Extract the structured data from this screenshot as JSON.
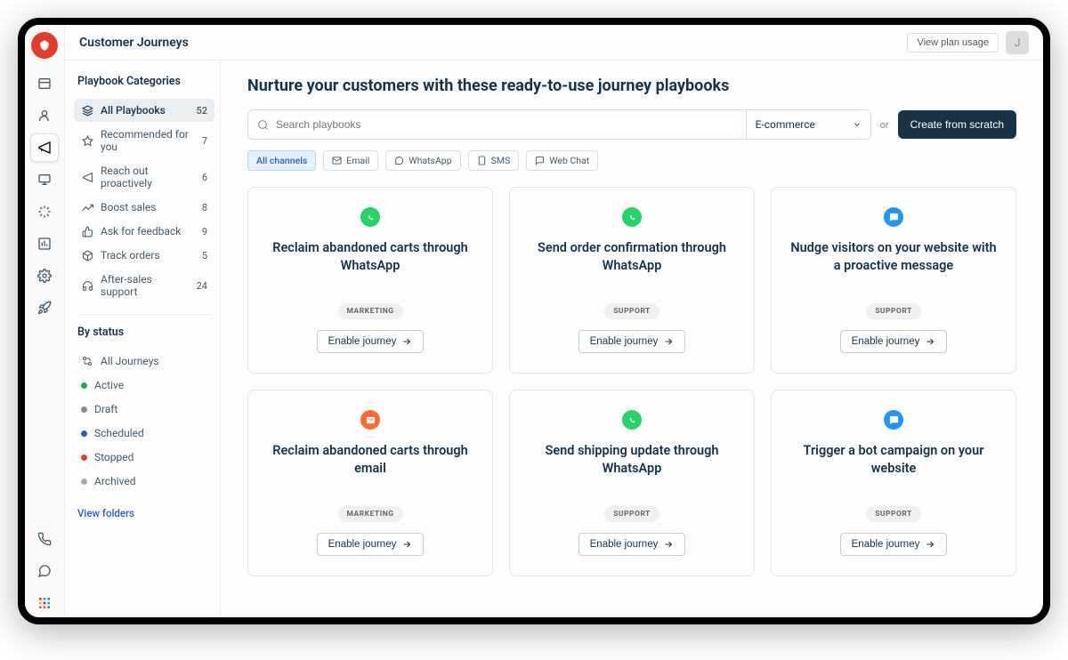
{
  "header": {
    "title": "Customer Journeys",
    "plan_button": "View plan usage",
    "avatar_initial": "J"
  },
  "sidebar": {
    "categories_heading": "Playbook Categories",
    "items": [
      {
        "label": "All Playbooks",
        "count": "52",
        "icon": "stack"
      },
      {
        "label": "Recommended for you",
        "count": "7",
        "icon": "star"
      },
      {
        "label": "Reach out proactively",
        "count": "6",
        "icon": "megaphone"
      },
      {
        "label": "Boost sales",
        "count": "8",
        "icon": "trend"
      },
      {
        "label": "Ask for feedback",
        "count": "9",
        "icon": "thumbs"
      },
      {
        "label": "Track orders",
        "count": "5",
        "icon": "package"
      },
      {
        "label": "After-sales support",
        "count": "24",
        "icon": "headset"
      }
    ],
    "status_heading": "By status",
    "status_items": [
      {
        "label": "All Journeys",
        "color": ""
      },
      {
        "label": "Active",
        "color": "#26a65b"
      },
      {
        "label": "Draft",
        "color": "#888"
      },
      {
        "label": "Scheduled",
        "color": "#2c5cc5"
      },
      {
        "label": "Stopped",
        "color": "#e43e2b"
      },
      {
        "label": "Archived",
        "color": "#aaa"
      }
    ],
    "view_folders": "View folders"
  },
  "content": {
    "title": "Nurture your customers with these ready-to-use journey playbooks",
    "search_placeholder": "Search playbooks",
    "select_value": "E-commerce",
    "or_text": "or",
    "create_button": "Create from scratch",
    "chips": [
      {
        "label": "All channels",
        "active": true
      },
      {
        "label": "Email",
        "icon": "mail"
      },
      {
        "label": "WhatsApp",
        "icon": "whatsapp"
      },
      {
        "label": "SMS",
        "icon": "sms"
      },
      {
        "label": "Web Chat",
        "icon": "chat"
      }
    ],
    "cards": [
      {
        "title": "Reclaim abandoned carts through WhatsApp",
        "tag": "MARKETING",
        "icon": "whatsapp",
        "button": "Enable journey"
      },
      {
        "title": "Send order confirmation through WhatsApp",
        "tag": "SUPPORT",
        "icon": "whatsapp",
        "button": "Enable journey"
      },
      {
        "title": "Nudge visitors on your website with a proactive message",
        "tag": "SUPPORT",
        "icon": "chat",
        "button": "Enable journey"
      },
      {
        "title": "Reclaim abandoned carts through email",
        "tag": "MARKETING",
        "icon": "email",
        "button": "Enable journey"
      },
      {
        "title": "Send shipping update through WhatsApp",
        "tag": "SUPPORT",
        "icon": "whatsapp",
        "button": "Enable journey"
      },
      {
        "title": "Trigger a bot campaign on your website",
        "tag": "SUPPORT",
        "icon": "chat",
        "button": "Enable journey"
      }
    ]
  }
}
